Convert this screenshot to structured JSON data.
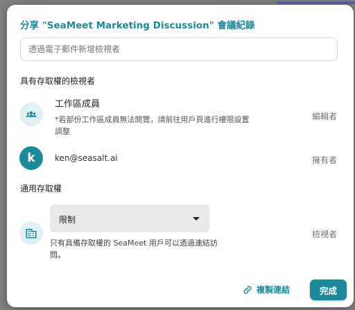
{
  "dialog": {
    "title": "分享 \"SeaMeet Marketing Discussion\" 會議紀錄",
    "email_placeholder": "透過電子郵件新增檢視者",
    "viewers_heading": "具有存取權的檢視者",
    "workspace": {
      "title": "工作區成員",
      "note": "*若部份工作區成員無法閱覽，請前往用戶頁進行權限設置調整",
      "role": "編輯者",
      "icon": "group-icon"
    },
    "owner": {
      "avatar_letter": "k",
      "email": "ken@seasalt.ai",
      "role": "擁有者"
    },
    "general_access": {
      "heading": "通用存取權",
      "selected": "限制",
      "description": "只有具備存取權的 SeaMeet 用戶可以透過連結訪問。",
      "role": "檢視者",
      "icon": "building-icon"
    },
    "copy_link_label": "複製連結",
    "done_label": "完成"
  },
  "colors": {
    "accent": "#1b8a9a",
    "accent_light": "#dff1f3",
    "select_bg": "#e9e9e9"
  }
}
